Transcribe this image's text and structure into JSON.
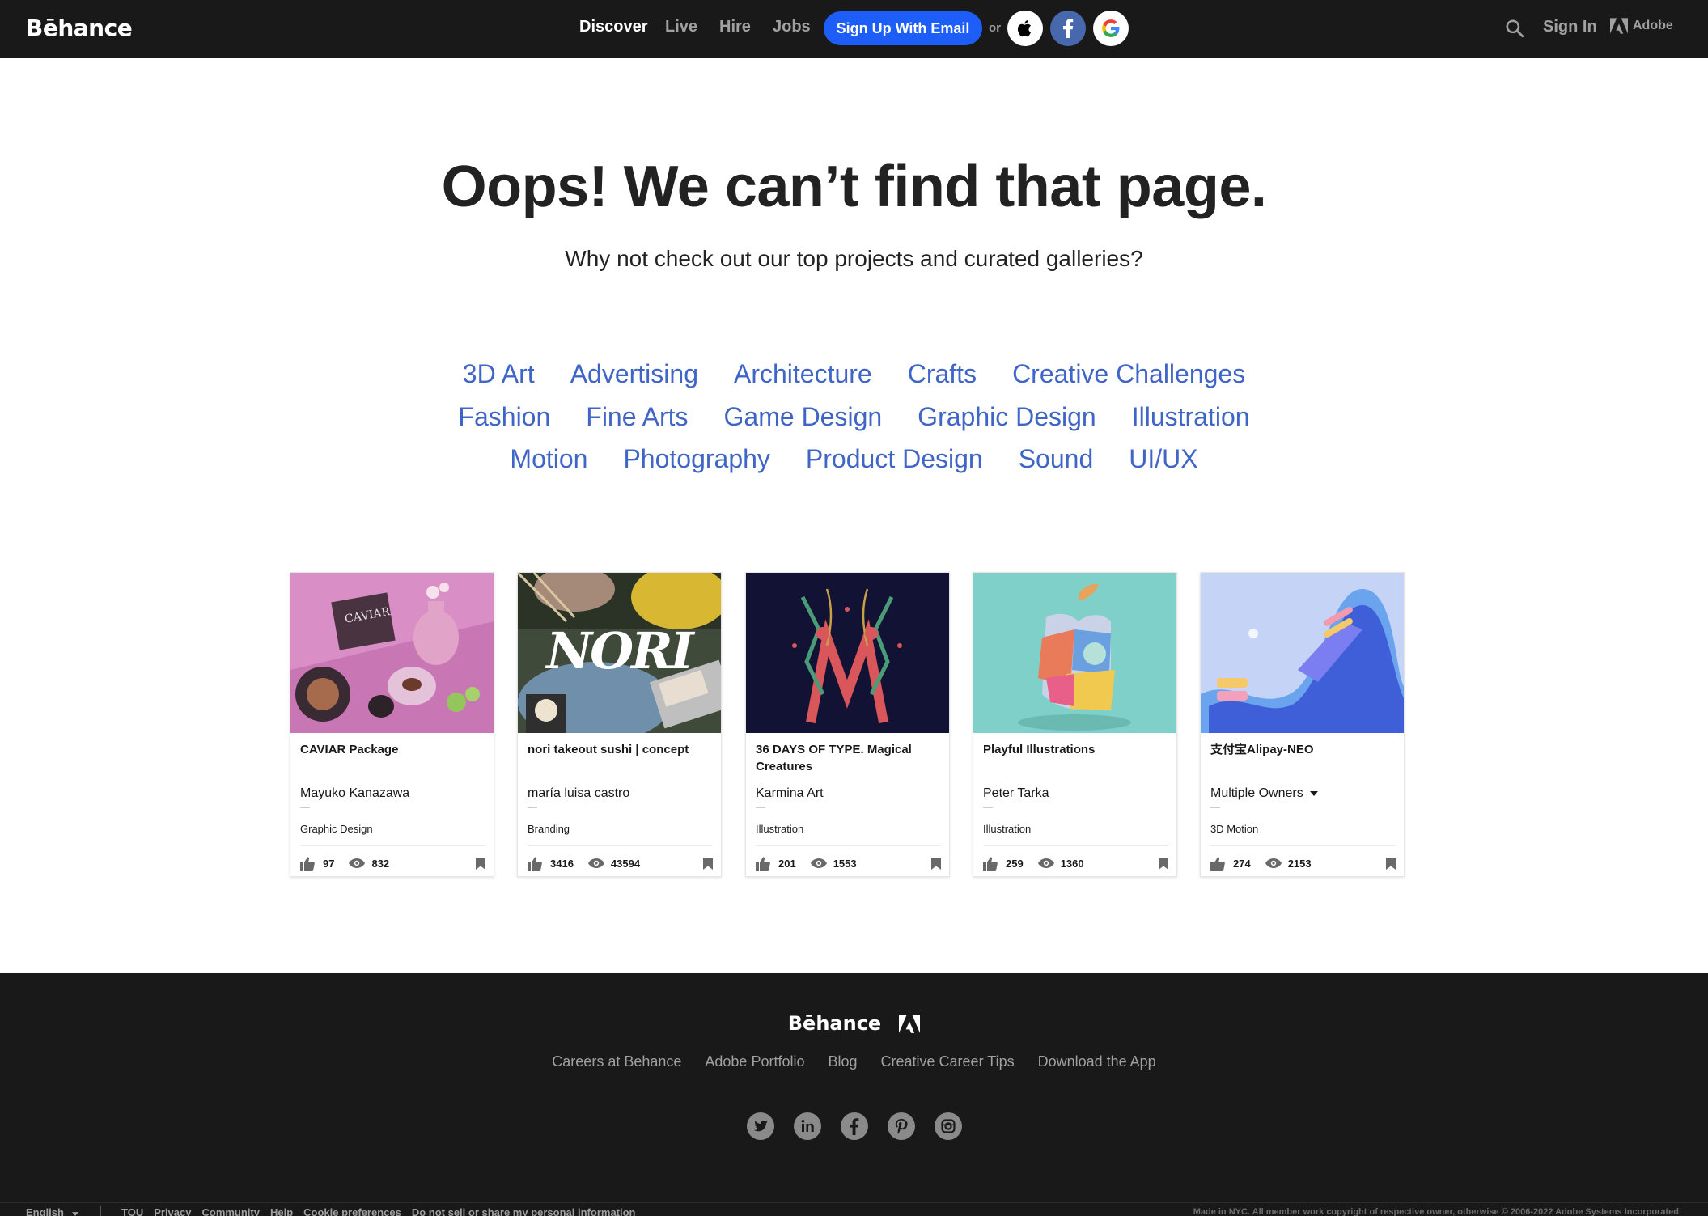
{
  "header": {
    "logo": "Bēhance",
    "nav": [
      "Discover",
      "Live",
      "Hire",
      "Jobs"
    ],
    "active_nav": "Discover",
    "signup_label": "Sign Up With Email",
    "or_label": "or",
    "signin_label": "Sign In",
    "adobe_label": "Adobe"
  },
  "main": {
    "headline": "Oops! We can’t find that page.",
    "subtitle": "Why not check out our top projects and curated galleries?",
    "categories_row1": [
      "3D Art",
      "Advertising",
      "Architecture",
      "Crafts",
      "Creative Challenges"
    ],
    "categories_row2": [
      "Fashion",
      "Fine Arts",
      "Game Design",
      "Graphic Design",
      "Illustration"
    ],
    "categories_row3": [
      "Motion",
      "Photography",
      "Product Design",
      "Sound",
      "UI/UX"
    ]
  },
  "projects": [
    {
      "title": "CAVIAR Package",
      "owner": "Mayuko Kanazawa",
      "field": "Graphic Design",
      "likes": "97",
      "views": "832",
      "thumb_text": "CAVIAR"
    },
    {
      "title": "nori takeout sushi | concept",
      "owner": "maría luisa castro",
      "field": "Branding",
      "likes": "3416",
      "views": "43594",
      "thumb_text": "NORI"
    },
    {
      "title": "36 DAYS OF TYPE. Magical Creatures",
      "owner": "Karmina Art",
      "field": "Illustration",
      "likes": "201",
      "views": "1553"
    },
    {
      "title": "Playful Illustrations",
      "owner": "Peter Tarka",
      "field": "Illustration",
      "likes": "259",
      "views": "1360"
    },
    {
      "title": "支付宝Alipay-NEO",
      "owner": "Multiple Owners",
      "field": "3D Motion",
      "likes": "274",
      "views": "2153"
    }
  ],
  "footer": {
    "logo": "Bēhance",
    "links": [
      "Careers at Behance",
      "Adobe Portfolio",
      "Blog",
      "Creative Career Tips",
      "Download the App"
    ],
    "social_icons": [
      "twitter-icon",
      "linkedin-icon",
      "facebook-icon",
      "pinterest-icon",
      "instagram-icon"
    ],
    "language": "English",
    "legal": [
      "TOU",
      "Privacy",
      "Community",
      "Help",
      "Cookie preferences",
      "Do not sell or share my personal information"
    ],
    "copyright": "Made in NYC. All member work copyright of respective owner, otherwise © 2006-2022 Adobe Systems Incorporated."
  },
  "colors": {
    "header_bg": "#191919",
    "accent_blue": "#1e5ef8",
    "category_link": "#3f65c7",
    "footer_bg": "#191919"
  }
}
